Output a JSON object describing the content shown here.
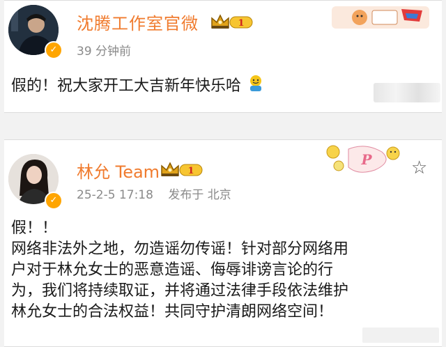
{
  "post1": {
    "author": "沈腾工作室官微",
    "vip_level": "1",
    "time": "39 分钟前",
    "text": "假的！祝大家开工大吉新年快乐哈"
  },
  "post2": {
    "author": "林允 Team",
    "vip_level": "1",
    "date": "25-2-5 17:18",
    "location": "发布于 北京",
    "lines": [
      "假！！",
      "网络非法外之地，勿造谣勿传谣！针对部分网络用",
      "户对于林允女士的恶意造谣、侮辱诽谤言论的行",
      "为，我们将持续取证，并将通过法律手段依法维护",
      "林允女士的合法权益！共同守护清朗网络空间！"
    ]
  },
  "colors": {
    "name": "#f07b2e",
    "badge": "#ffa500",
    "meta": "#8a8a8a",
    "text": "#1a1a1a"
  },
  "icons": [
    "verified-badge-icon",
    "crown-badge-icon",
    "star-icon",
    "emoji-icon"
  ]
}
